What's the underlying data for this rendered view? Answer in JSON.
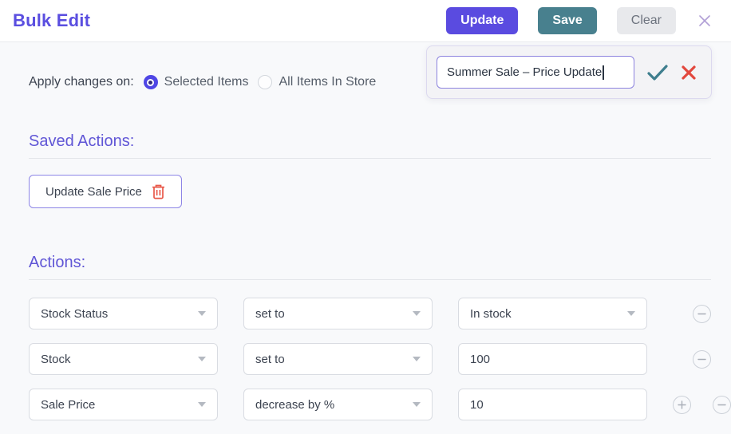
{
  "header": {
    "title": "Bulk Edit",
    "update_label": "Update",
    "save_label": "Save",
    "clear_label": "Clear"
  },
  "save_popup": {
    "input_value": "Summer Sale – Price Update"
  },
  "apply": {
    "label": "Apply changes on:",
    "options": [
      {
        "label": "Selected Items",
        "selected": true
      },
      {
        "label": "All Items In Store",
        "selected": false
      }
    ]
  },
  "saved_actions": {
    "heading": "Saved Actions:",
    "items": [
      {
        "label": "Update Sale Price"
      }
    ]
  },
  "actions": {
    "heading": "Actions:",
    "rows": [
      {
        "field": "Stock Status",
        "operation": "set to",
        "value": "In stock",
        "value_kind": "select"
      },
      {
        "field": "Stock",
        "operation": "set to",
        "value": "100",
        "value_kind": "input"
      },
      {
        "field": "Sale Price",
        "operation": "decrease by %",
        "value": "10",
        "value_kind": "input"
      }
    ]
  },
  "colors": {
    "accent_purple": "#5a4be0",
    "teal": "#48808e",
    "danger_red": "#e2473d",
    "trash_red": "#e8594a",
    "check_teal": "#3e7e8e",
    "heading_purple": "#6056d6"
  }
}
